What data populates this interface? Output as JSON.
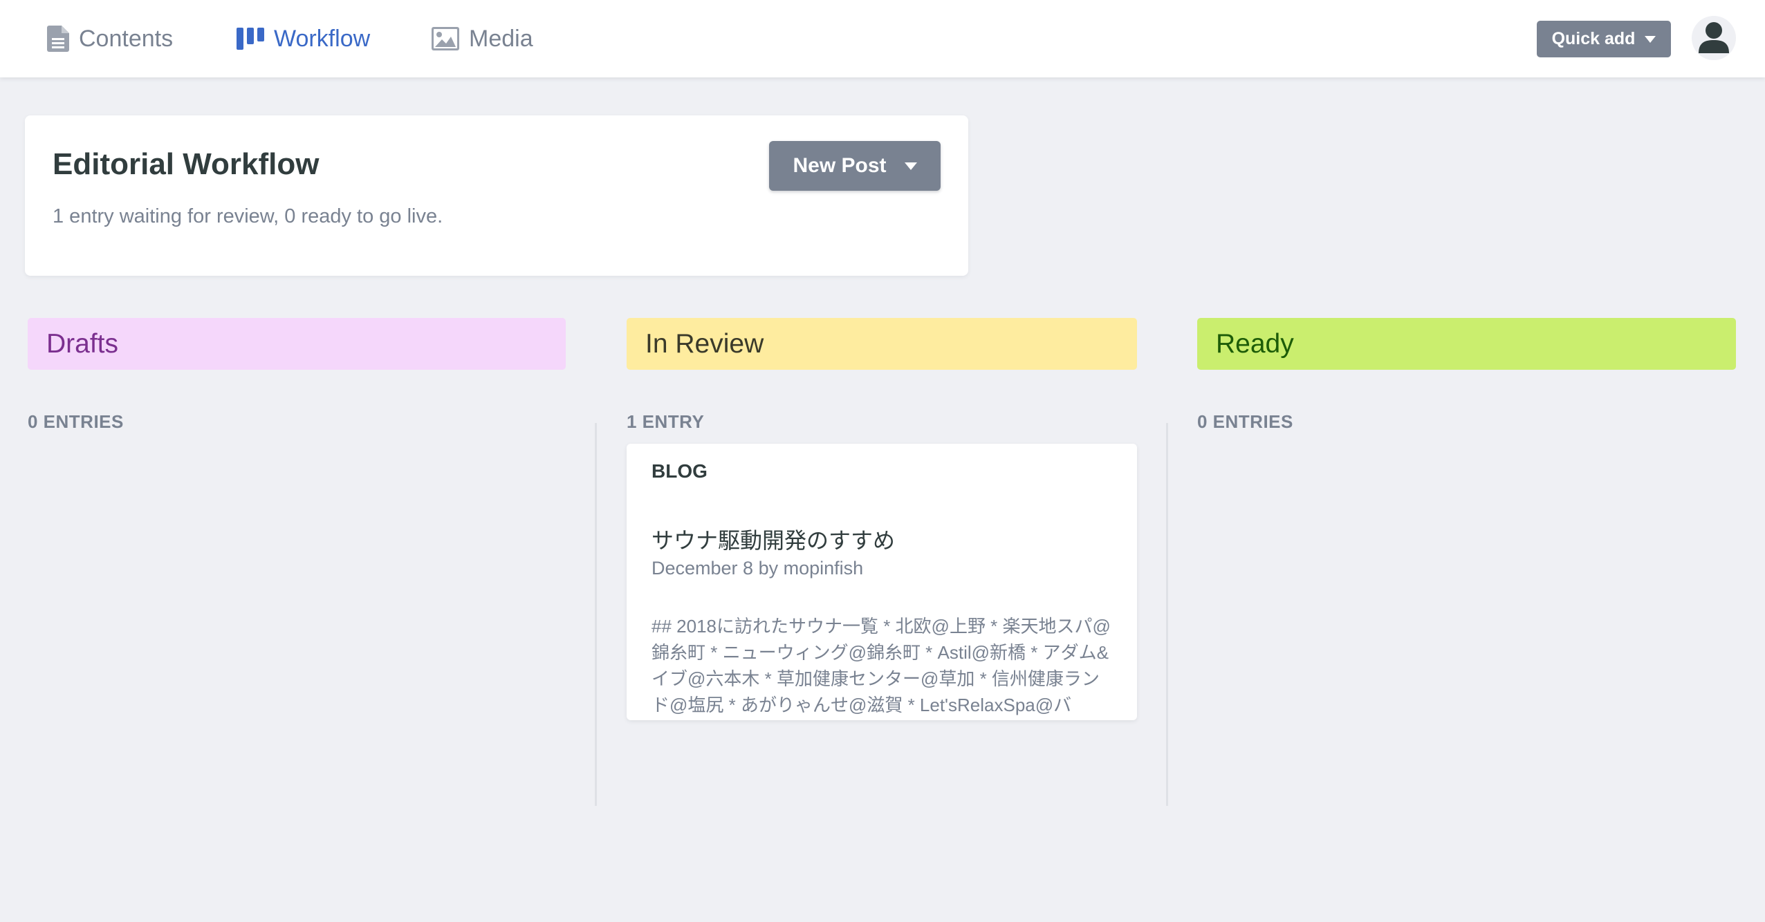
{
  "nav": {
    "items": [
      {
        "label": "Contents",
        "icon": "document-icon"
      },
      {
        "label": "Workflow",
        "icon": "kanban-icon",
        "active": true
      },
      {
        "label": "Media",
        "icon": "image-icon"
      }
    ],
    "quick_add_label": "Quick add",
    "accent_color": "#3a69c7"
  },
  "header": {
    "title": "Editorial Workflow",
    "summary": "1 entry waiting for review, 0 ready to go live.",
    "new_post_label": "New Post"
  },
  "columns": [
    {
      "title": "Drafts",
      "count_label": "0 ENTRIES",
      "color": "#f5d7fb"
    },
    {
      "title": "In Review",
      "count_label": "1 ENTRY",
      "color": "#feec9f"
    },
    {
      "title": "Ready",
      "count_label": "0 ENTRIES",
      "color": "#caee6e"
    }
  ],
  "entry": {
    "collection": "BLOG",
    "title": "サウナ駆動開発のすすめ",
    "meta": "December 8 by mopinfish",
    "excerpt": "## 2018に訪れたサウナ一覧 * 北欧@上野 * 楽天地スパ@錦糸町 * ニューウィング@錦糸町 * Astil@新橋 * アダム&イブ@六本木 * 草加健康センター@草加 * 信州健康ランド@塩尻 * あがりゃんせ@滋賀 * Let'sRelaxSpa@バ"
  }
}
